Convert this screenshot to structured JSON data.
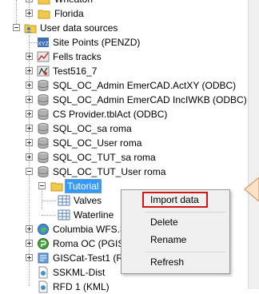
{
  "tree": {
    "items": [
      {
        "label": "Wheaton"
      },
      {
        "label": "Florida"
      },
      {
        "label": "User data sources"
      },
      {
        "label": "Site Points (PENZD)"
      },
      {
        "label": "Fells tracks"
      },
      {
        "label": "Test516_7"
      },
      {
        "label": "SQL_OC_Admin EmerCAD.ActXY (ODBC)"
      },
      {
        "label": "SQL_OC_Admin EmerCAD IncIWKB (ODBC)"
      },
      {
        "label": "CS Provider.tblAct (ODBC)"
      },
      {
        "label": "SQL_OC_sa roma"
      },
      {
        "label": "SQL_OC_User roma"
      },
      {
        "label": "SQL_OC_TUT_sa roma"
      },
      {
        "label": "SQL_OC_TUT_User roma"
      },
      {
        "label": "Tutorial"
      },
      {
        "label": "Valves"
      },
      {
        "label": "Waterline"
      },
      {
        "label": "Columbia WFS.3"
      },
      {
        "label": "Roma OC (PGIS)"
      },
      {
        "label": "GISCat-Test1 (Re"
      },
      {
        "label": "SSKML-Dist"
      },
      {
        "label": "RFD 1 (KML)"
      }
    ]
  },
  "context_menu": {
    "items": [
      {
        "label": "Import data"
      },
      {
        "label": "Delete"
      },
      {
        "label": "Rename"
      },
      {
        "label": "Refresh"
      }
    ]
  },
  "colors": {
    "selection": "#3399ff",
    "highlight_box": "#d01818",
    "folder": "#f2c94c",
    "database": "#a9a9a9"
  }
}
